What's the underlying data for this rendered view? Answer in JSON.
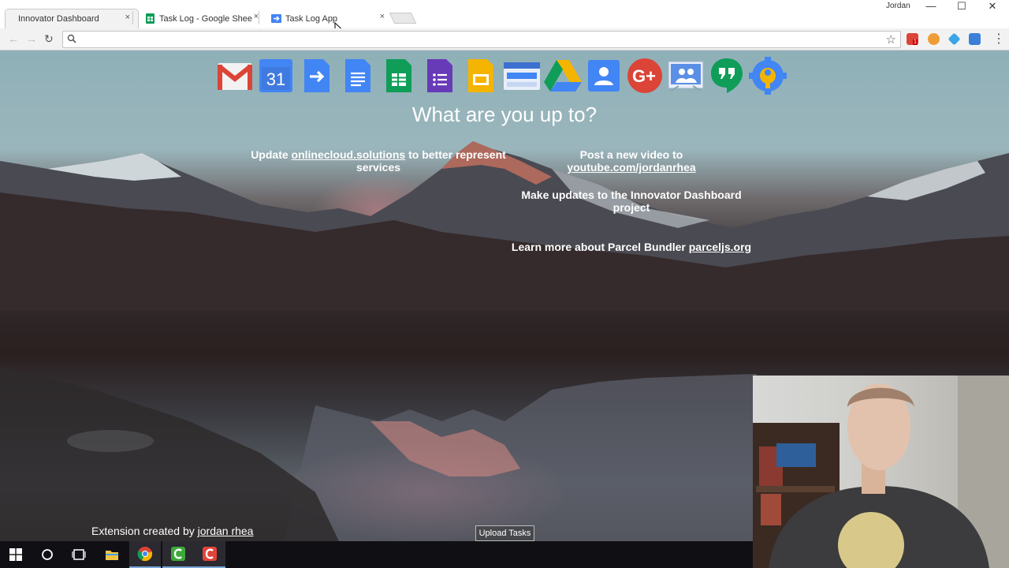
{
  "window": {
    "user": "Jordan",
    "minimize": "—",
    "maximize": "☐",
    "close": "✕"
  },
  "tabs": [
    {
      "label": "Innovator Dashboard",
      "close": "×",
      "active": true
    },
    {
      "label": "Task Log - Google Sheets",
      "close": "×",
      "active": false,
      "icon": "sheets-icon"
    },
    {
      "label": "Task Log App",
      "close": "×",
      "active": false,
      "icon": "apps-script-icon"
    }
  ],
  "toolbar": {
    "back": "←",
    "forward": "→",
    "reload": "↻",
    "address_value": "",
    "star": "☆",
    "menu": "⋮",
    "gmail_badge": "1"
  },
  "apps": [
    "gmail",
    "calendar",
    "apps-script",
    "docs",
    "sheets",
    "forms",
    "slides",
    "sites",
    "drive",
    "contacts",
    "google-plus",
    "classroom",
    "hangouts",
    "admin"
  ],
  "calendar_day": "31",
  "page": {
    "heading": "What are you up to?",
    "tasks": [
      {
        "prefix": "Update ",
        "link": "onlinecloud.solutions",
        "suffix": " to better represent services"
      },
      {
        "prefix": "Post a new video to ",
        "link": "youtube.com/jordanrhea",
        "suffix": ""
      },
      {
        "prefix": "Make updates to the Innovator Dashboard project",
        "link": "",
        "suffix": ""
      },
      {
        "prefix": "Learn more about Parcel Bundler ",
        "link": "parceljs.org",
        "suffix": ""
      }
    ],
    "credit_prefix": "Extension created by ",
    "credit_link": "jordan rhea",
    "upload_button": "Upload Tasks"
  },
  "taskbar": [
    "windows-start",
    "cortana",
    "task-view",
    "file-explorer",
    "chrome",
    "camtasia",
    "recorder"
  ],
  "colors": {
    "gmail_red": "#db4437",
    "blue": "#4285f4",
    "green": "#0f9d58",
    "yellow": "#f4b400",
    "purple": "#673ab7"
  }
}
